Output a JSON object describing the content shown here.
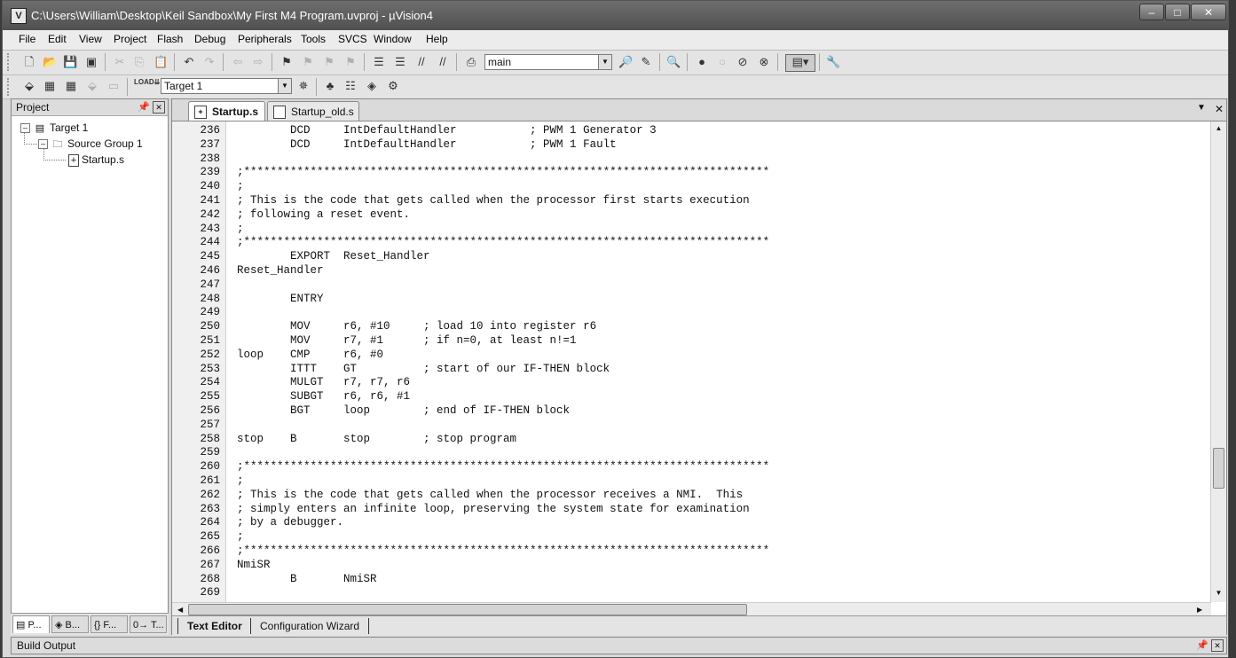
{
  "window": {
    "title": "C:\\Users\\William\\Desktop\\Keil Sandbox\\My First M4 Program.uvproj - µVision4",
    "app_icon": "V",
    "minimize": "–",
    "maximize": "□",
    "close": "✕"
  },
  "menu": [
    "File",
    "Edit",
    "View",
    "Project",
    "Flash",
    "Debug",
    "Peripherals",
    "Tools",
    "SVCS",
    "Window",
    "Help"
  ],
  "toolbar1": {
    "find_value": "main"
  },
  "toolbar2": {
    "target_value": "Target 1"
  },
  "project_panel": {
    "title": "Project",
    "tree": [
      {
        "label": "Target 1",
        "toggle": "–"
      },
      {
        "label": "Source Group 1",
        "toggle": "–"
      },
      {
        "label": "Startup.s"
      }
    ],
    "tabs": [
      "P...",
      "B...",
      "{} F...",
      "0→ T..."
    ]
  },
  "editor": {
    "tabs": [
      "Startup.s",
      "Startup_old.s"
    ],
    "bottom_tabs": [
      "Text Editor",
      "Configuration Wizard"
    ],
    "lines": [
      {
        "num": "236",
        "text": "        DCD     IntDefaultHandler           ; PWM 1 Generator 3"
      },
      {
        "num": "237",
        "text": "        DCD     IntDefaultHandler           ; PWM 1 Fault"
      },
      {
        "num": "238",
        "text": ""
      },
      {
        "num": "239",
        "text": ";*******************************************************************************"
      },
      {
        "num": "240",
        "text": ";"
      },
      {
        "num": "241",
        "text": "; This is the code that gets called when the processor first starts execution"
      },
      {
        "num": "242",
        "text": "; following a reset event."
      },
      {
        "num": "243",
        "text": ";"
      },
      {
        "num": "244",
        "text": ";*******************************************************************************"
      },
      {
        "num": "245",
        "text": "        EXPORT  Reset_Handler"
      },
      {
        "num": "246",
        "text": "Reset_Handler"
      },
      {
        "num": "247",
        "text": ""
      },
      {
        "num": "248",
        "text": "        ENTRY"
      },
      {
        "num": "249",
        "text": ""
      },
      {
        "num": "250",
        "text": "        MOV     r6, #10     ; load 10 into register r6"
      },
      {
        "num": "251",
        "text": "        MOV     r7, #1      ; if n=0, at least n!=1"
      },
      {
        "num": "252",
        "text": "loop    CMP     r6, #0"
      },
      {
        "num": "253",
        "text": "        ITTT    GT          ; start of our IF-THEN block"
      },
      {
        "num": "254",
        "text": "        MULGT   r7, r7, r6"
      },
      {
        "num": "255",
        "text": "        SUBGT   r6, r6, #1"
      },
      {
        "num": "256",
        "text": "        BGT     loop        ; end of IF-THEN block"
      },
      {
        "num": "257",
        "text": ""
      },
      {
        "num": "258",
        "text": "stop    B       stop        ; stop program"
      },
      {
        "num": "259",
        "text": ""
      },
      {
        "num": "260",
        "text": ";*******************************************************************************"
      },
      {
        "num": "261",
        "text": ";"
      },
      {
        "num": "262",
        "text": "; This is the code that gets called when the processor receives a NMI.  This"
      },
      {
        "num": "263",
        "text": "; simply enters an infinite loop, preserving the system state for examination"
      },
      {
        "num": "264",
        "text": "; by a debugger."
      },
      {
        "num": "265",
        "text": ";"
      },
      {
        "num": "266",
        "text": ";*******************************************************************************"
      },
      {
        "num": "267",
        "text": "NmiSR"
      },
      {
        "num": "268",
        "text": "        B       NmiSR"
      },
      {
        "num": "269",
        "text": ""
      }
    ]
  },
  "build_output": {
    "title": "Build Output"
  }
}
